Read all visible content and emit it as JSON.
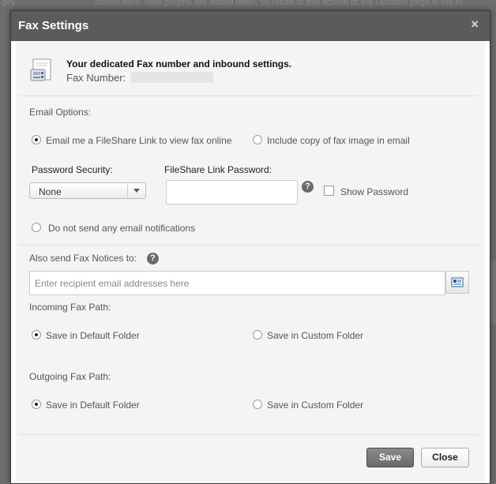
{
  "dialog": {
    "title": "Fax Settings",
    "close_glyph": "×",
    "heading": "Your dedicated Fax number and inbound settings.",
    "fax_number_label": "Fax Number:"
  },
  "email_options": {
    "label": "Email Options:",
    "filesharelink_option": "Email me a FileShare Link to view fax online",
    "include_copy_option": "Include copy of fax image in email",
    "selected": "filesharelink_option"
  },
  "password": {
    "security_label": "Password Security:",
    "security_value": "None",
    "link_password_label": "FileShare Link Password:",
    "link_password_value": "",
    "show_password_label": "Show Password",
    "show_password_checked": false
  },
  "no_notifications_label": "Do not send any email notifications",
  "notices": {
    "label": "Also send Fax Notices to:",
    "placeholder": "Enter recipient email addresses here",
    "value": ""
  },
  "incoming": {
    "label": "Incoming Fax Path:",
    "default_option": "Save in Default Folder",
    "custom_option": "Save in Custom Folder",
    "selected": "default"
  },
  "outgoing": {
    "label": "Outgoing Fax Path:",
    "default_option": "Save in Default Folder",
    "custom_option": "Save in Custom Folder",
    "selected": "default"
  },
  "help_glyph": "?",
  "buttons": {
    "save": "Save",
    "close": "Close"
  },
  "background": {
    "top_text": "shown here. New plugins are added often, so return to this screen or the Updates page in the fo",
    "left_text": "gify"
  },
  "colors": {
    "titlebar": "#5b5b5b",
    "save_button": "#7a7a7a",
    "overlay": "#6e6e6e"
  }
}
